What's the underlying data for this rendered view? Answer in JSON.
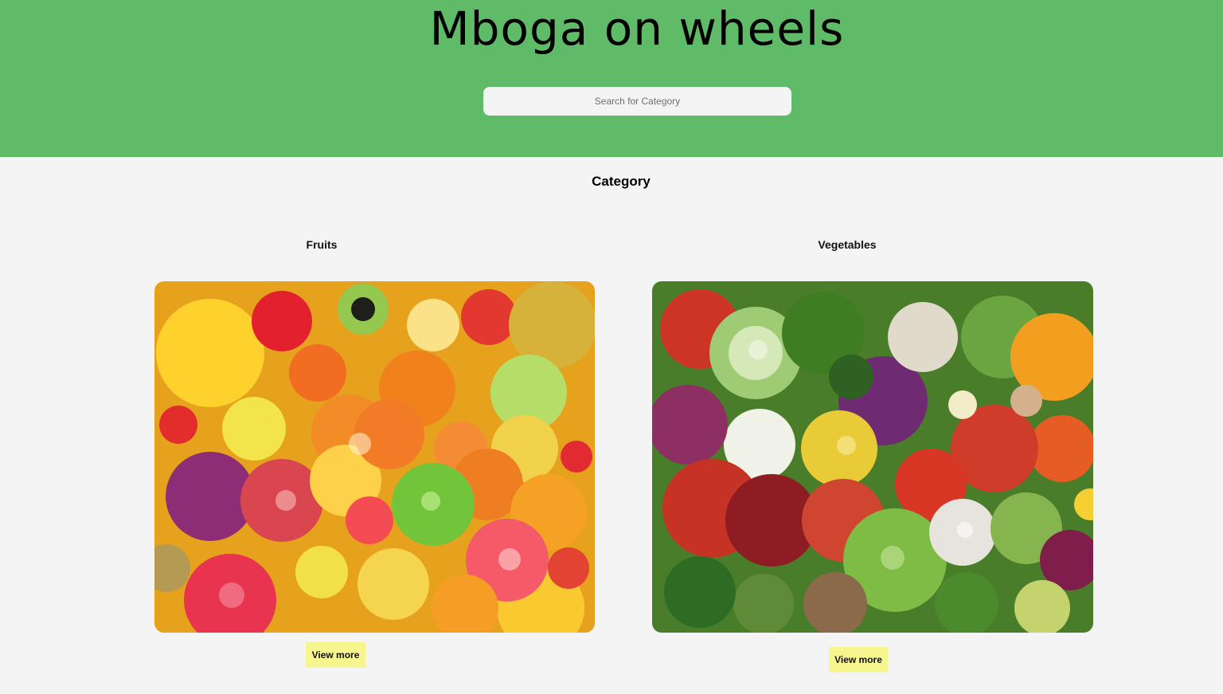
{
  "header": {
    "title": "Mboga on wheels",
    "search_placeholder": "Search for Category",
    "background_color": "#5fbb67"
  },
  "main": {
    "section_title": "Category",
    "categories": [
      {
        "label": "Fruits",
        "image_name": "fruits-image",
        "button_label": "View more"
      },
      {
        "label": "Vegetables",
        "image_name": "vegetables-image",
        "button_label": "View more"
      }
    ],
    "button_color": "#f7f58e"
  }
}
